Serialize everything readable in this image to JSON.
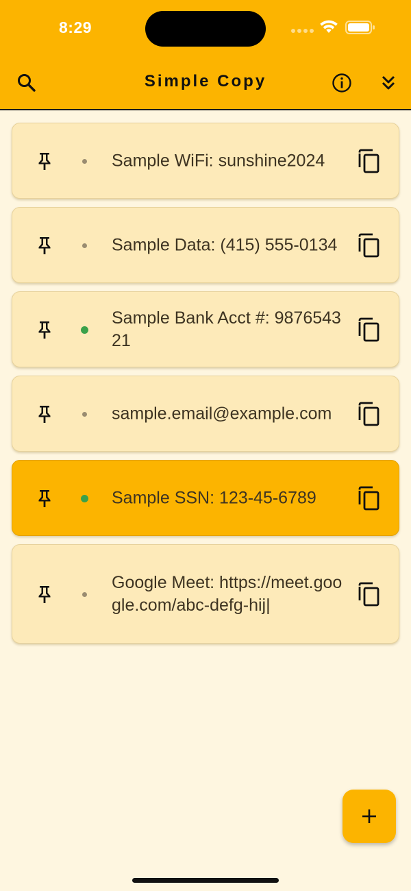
{
  "status_bar": {
    "time": "8:29"
  },
  "app_bar": {
    "title": "Simple Copy",
    "search_icon": "search-icon",
    "info_icon": "info-icon",
    "collapse_icon": "double-chevron-down-icon",
    "background": "#fcb400"
  },
  "items": [
    {
      "text": "Sample WiFi: sunshine2024",
      "indicator": "grey",
      "highlighted": false
    },
    {
      "text": "Sample Data: (415) 555-0134",
      "indicator": "grey",
      "highlighted": false
    },
    {
      "text": "Sample Bank Acct #: 987654321",
      "indicator": "green",
      "highlighted": false
    },
    {
      "text": "sample.email@example.com",
      "indicator": "grey",
      "highlighted": false
    },
    {
      "text": "Sample SSN: 123-45-6789",
      "indicator": "green",
      "highlighted": true
    },
    {
      "text": "Google Meet: https://meet.google.com/abc-defg-hij|",
      "indicator": "grey",
      "highlighted": false
    }
  ],
  "fab": {
    "icon": "plus-icon"
  },
  "colors": {
    "accent": "#fcb400",
    "card": "#fdeab9",
    "page": "#fef6e0",
    "indicator_green": "#3aa14a",
    "indicator_grey": "#9a8c70"
  }
}
